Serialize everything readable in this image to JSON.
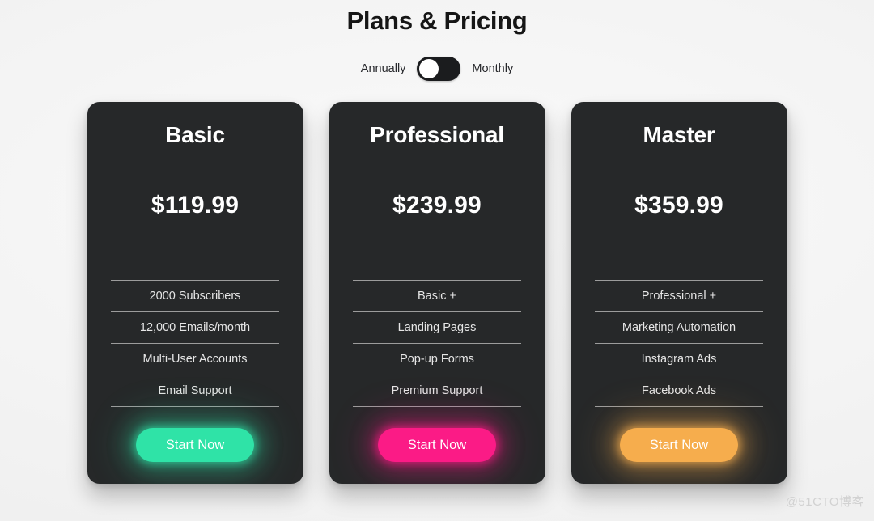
{
  "header": {
    "title": "Plans & Pricing"
  },
  "billing": {
    "left_label": "Annually",
    "right_label": "Monthly",
    "selected": "Annually",
    "knob_position": "left"
  },
  "plans": [
    {
      "name": "Basic",
      "price": "$119.99",
      "features": [
        "2000 Subscribers",
        "12,000 Emails/month",
        "Multi-User Accounts",
        "Email Support"
      ],
      "cta_label": "Start Now",
      "accent_color": "#2fe3a7"
    },
    {
      "name": "Professional",
      "price": "$239.99",
      "features": [
        "Basic +",
        "Landing Pages",
        "Pop-up Forms",
        "Premium Support"
      ],
      "cta_label": "Start Now",
      "accent_color": "#fb1b86"
    },
    {
      "name": "Master",
      "price": "$359.99",
      "features": [
        "Professional +",
        "Marketing Automation",
        "Instagram Ads",
        "Facebook Ads"
      ],
      "cta_label": "Start Now",
      "accent_color": "#f6ad4d"
    }
  ],
  "watermark": {
    "text": "@51CTO博客"
  },
  "colors": {
    "page_background": "#f4f4f4",
    "card_background": "#262829",
    "divider": "#9c9c9c",
    "text_light": "#ffffff",
    "toggle_track": "#1b1c1e"
  }
}
